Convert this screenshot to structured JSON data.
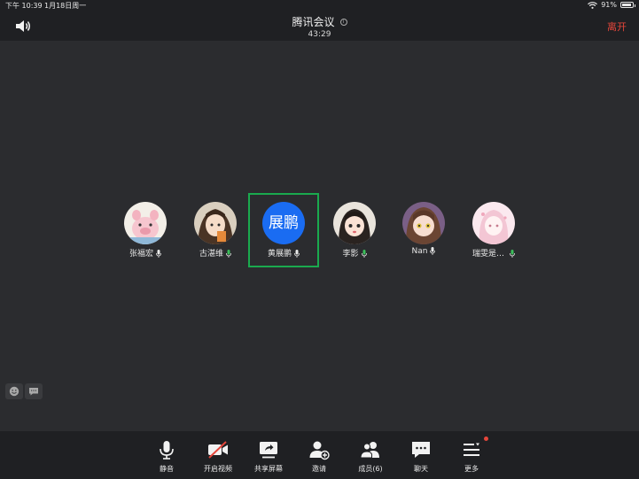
{
  "statusbar": {
    "time": "下午 10:39",
    "date": "1月18日周一",
    "battery": "91%",
    "battery_level": 0.91
  },
  "header": {
    "title": "腾讯会议",
    "timer": "43:29",
    "leave_label": "离开"
  },
  "participants": [
    {
      "name": "张福宏",
      "avatar": "pig-avatar",
      "active": false
    },
    {
      "name": "古湛维",
      "avatar": "anime-girl-avatar",
      "active": false
    },
    {
      "name": "黄展鹏",
      "avatar_text": "展鹏",
      "active": true
    },
    {
      "name": "李影",
      "avatar": "cartoon-girl-avatar",
      "active": false
    },
    {
      "name": "Nan",
      "avatar": "anime-girl-avatar-2",
      "active": false
    },
    {
      "name": "瑞雯是…",
      "avatar": "pink-anime-avatar",
      "active": false
    }
  ],
  "toolbar": {
    "mute_label": "静音",
    "video_label": "开启视频",
    "share_label": "共享屏幕",
    "invite_label": "邀请",
    "members_label": "成员(6)",
    "chat_label": "聊天",
    "more_label": "更多"
  },
  "colors": {
    "background": "#2b2c2f",
    "bar": "#1f2023",
    "accent_blue": "#1a6cf2",
    "active_border": "#1aaa4e",
    "leave_red": "#e5463b",
    "mic_green": "#3bbf5b"
  }
}
